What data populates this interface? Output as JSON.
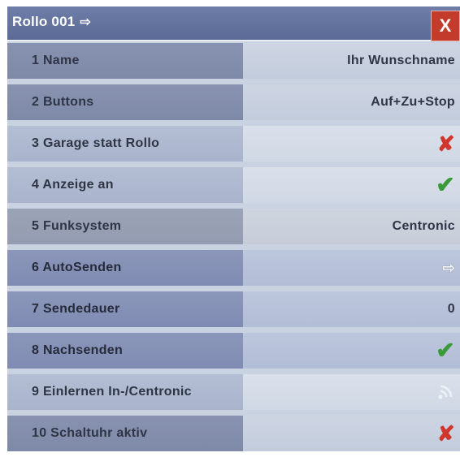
{
  "window": {
    "title": "Rollo 001",
    "title_arrow": "⇨",
    "close_label": "X"
  },
  "rows": [
    {
      "label": "1 Name",
      "value": "Ihr Wunschname"
    },
    {
      "label": "2 Buttons",
      "value": "Auf+Zu+Stop"
    },
    {
      "label": "3 Garage statt Rollo",
      "value": "✘"
    },
    {
      "label": "4 Anzeige an",
      "value": "✔"
    },
    {
      "label": "5 Funksystem",
      "value": "Centronic"
    },
    {
      "label": "6 AutoSenden",
      "value": "⇨"
    },
    {
      "label": "7 Sendedauer",
      "value": "0"
    },
    {
      "label": "8 Nachsenden",
      "value": "✔"
    },
    {
      "label": "9 Einlernen In-/Centronic",
      "value": ""
    },
    {
      "label": "10 Schaltuhr aktiv",
      "value": "✘"
    }
  ],
  "icons": {
    "row3": "cross-icon",
    "row4": "check-icon",
    "row6": "arrow-right-icon",
    "row8": "check-icon",
    "row9": "signal-icon",
    "row10": "cross-icon"
  },
  "colors": {
    "titlebar": "#5b6a96",
    "close": "#c23b2b",
    "cross": "#d0362c",
    "check": "#3a9a3a"
  }
}
